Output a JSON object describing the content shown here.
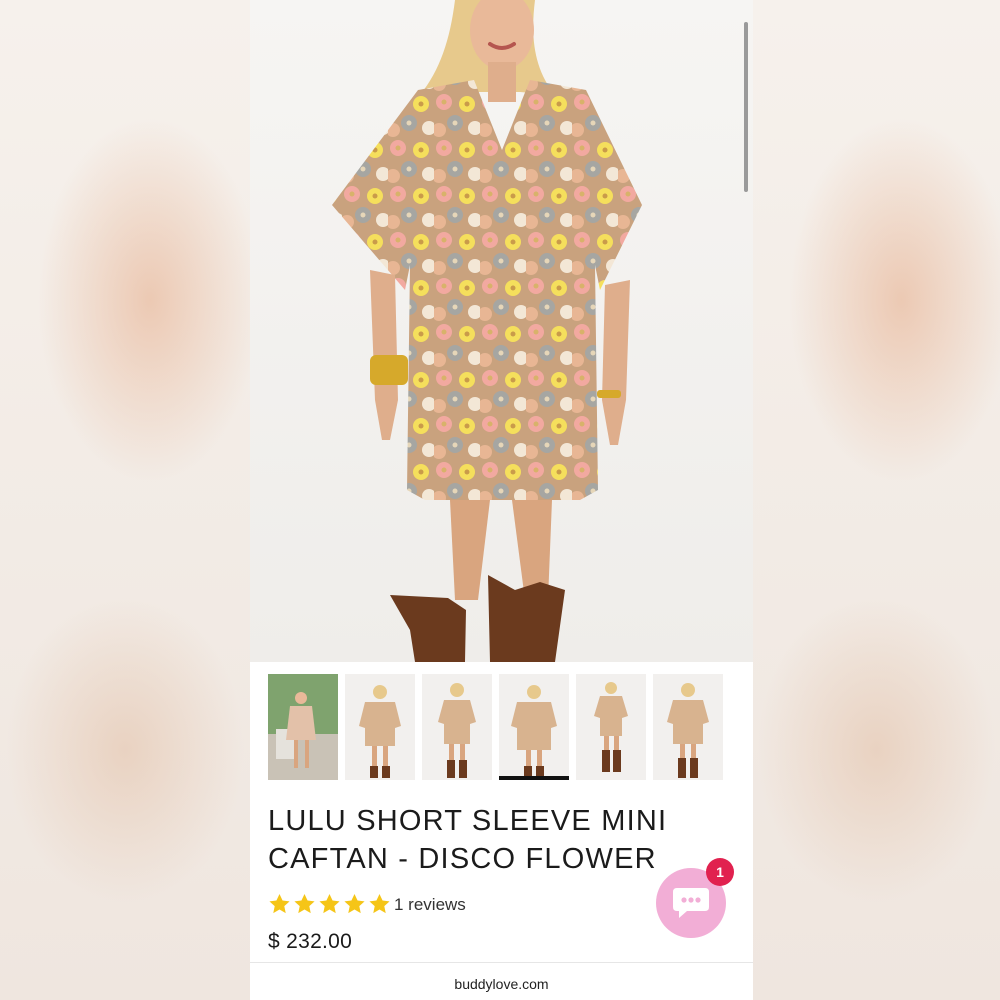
{
  "product": {
    "title": "LULU SHORT SLEEVE MINI CAFTAN - DISCO FLOWER",
    "rating": 5,
    "reviews_text": "1 reviews",
    "price": "$ 232.00"
  },
  "gallery": {
    "thumbnail_count": 6,
    "active_thumbnail": 4
  },
  "chat": {
    "badge_count": "1"
  },
  "footer": {
    "url": "buddylove.com"
  },
  "colors": {
    "star": "#f5c518",
    "chat_button": "#f2aed6",
    "badge": "#e1214f",
    "text": "#1b1b1b"
  },
  "icons": {
    "chat": "chat-bubble-icon",
    "star": "star-icon"
  }
}
